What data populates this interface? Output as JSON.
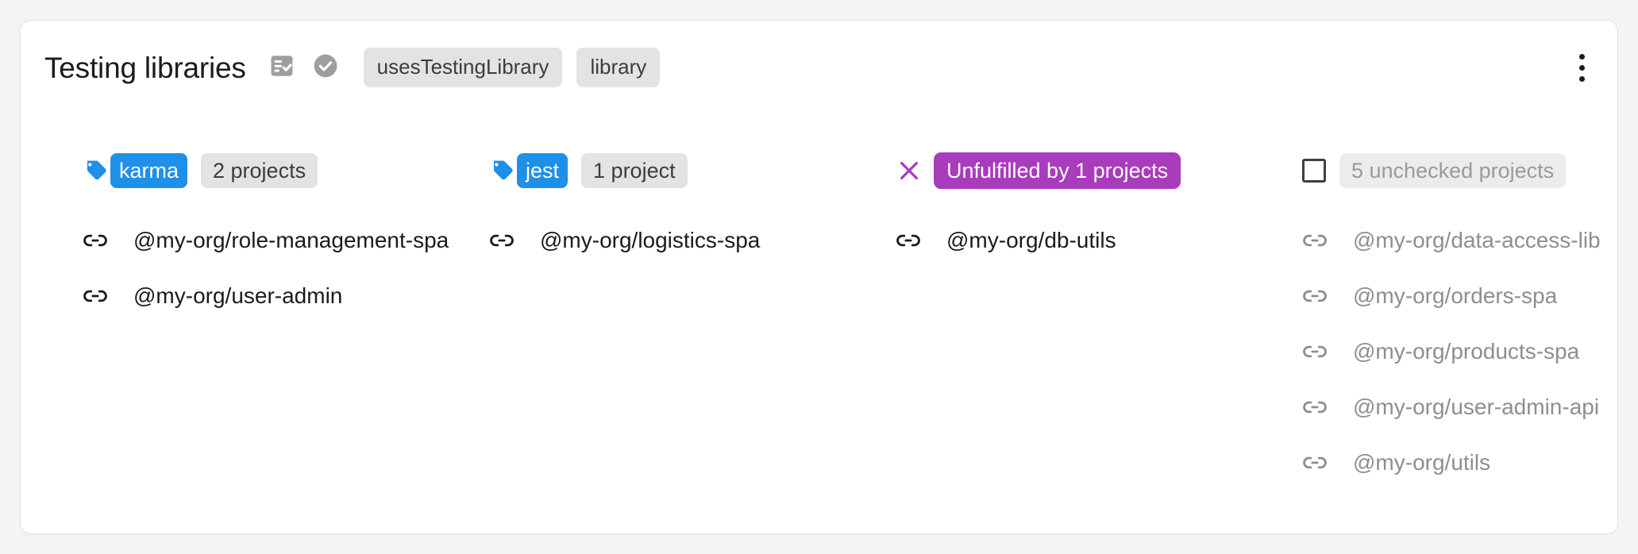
{
  "header": {
    "title": "Testing libraries",
    "icons": [
      {
        "name": "fact-check-icon",
        "color": "#9e9e9e"
      },
      {
        "name": "check-circle-icon",
        "color": "#9e9e9e"
      }
    ],
    "chips": [
      {
        "label": "usesTestingLibrary"
      },
      {
        "label": "library"
      }
    ],
    "menu": {
      "name": "more-options-menu",
      "label": "More options"
    }
  },
  "colors": {
    "page_background": "#f4f4f4",
    "card_background": "#ffffff",
    "tag_blue": "#1e90e8",
    "unfulfilled_purple": "#a93bbd",
    "chip_gray": "#e3e3e3",
    "muted_text": "#8e8e8e",
    "text": "#1b1b1b"
  },
  "columns": [
    {
      "id": "karma",
      "badge": {
        "kind": "tag",
        "icon": "tag-icon",
        "label": "karma",
        "count_label": "2 projects"
      },
      "projects": [
        {
          "name": "@my-org/role-management-spa",
          "icon": "link-icon"
        },
        {
          "name": "@my-org/user-admin",
          "icon": "link-icon"
        }
      ]
    },
    {
      "id": "jest",
      "badge": {
        "kind": "tag",
        "icon": "tag-icon",
        "label": "jest",
        "count_label": "1 project"
      },
      "projects": [
        {
          "name": "@my-org/logistics-spa",
          "icon": "link-icon"
        }
      ]
    },
    {
      "id": "unfulfilled",
      "badge": {
        "kind": "unfulfilled",
        "icon": "close-x-icon",
        "label": "Unfulfilled by 1 projects"
      },
      "projects": [
        {
          "name": "@my-org/db-utils",
          "icon": "link-icon"
        }
      ]
    },
    {
      "id": "unchecked",
      "badge": {
        "kind": "unchecked",
        "icon": "checkbox-unchecked-icon",
        "label": "5 unchecked projects"
      },
      "projects": [
        {
          "name": "@my-org/data-access-lib",
          "icon": "link-icon"
        },
        {
          "name": "@my-org/orders-spa",
          "icon": "link-icon"
        },
        {
          "name": "@my-org/products-spa",
          "icon": "link-icon"
        },
        {
          "name": "@my-org/user-admin-api",
          "icon": "link-icon"
        },
        {
          "name": "@my-org/utils",
          "icon": "link-icon"
        }
      ]
    }
  ]
}
